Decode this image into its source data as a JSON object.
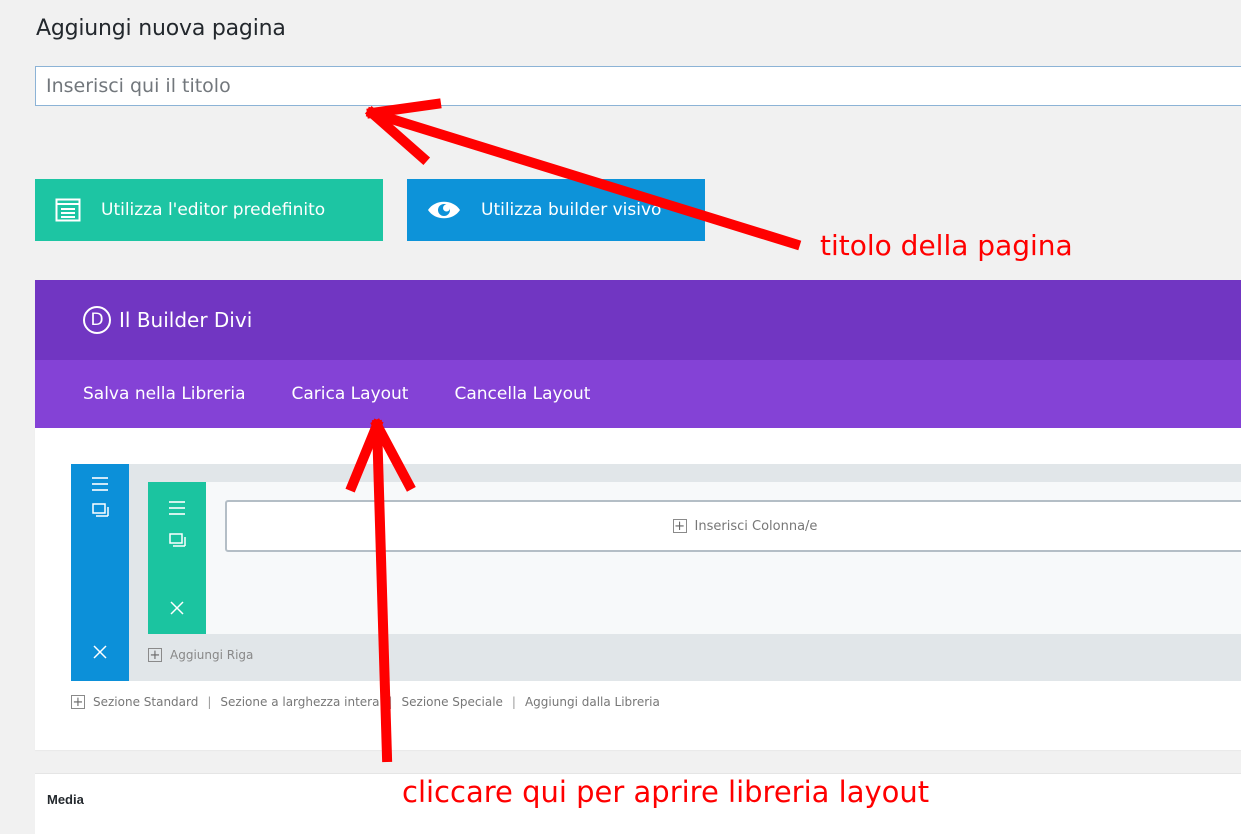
{
  "page": {
    "heading": "Aggiungi nuova pagina",
    "title_placeholder": "Inserisci qui il titolo"
  },
  "buttons": {
    "default_editor": "Utilizza l'editor predefinito",
    "visual_builder": "Utilizza builder visivo"
  },
  "builder": {
    "logo_letter": "D",
    "title": "Il Builder Divi",
    "toolbar": [
      "Salva nella Libreria",
      "Carica Layout",
      "Cancella Layout"
    ],
    "insert_columns": "Inserisci Colonna/e",
    "add_row": "Aggiungi Riga",
    "section_links": [
      "Sezione Standard",
      "Sezione a larghezza intera",
      "Sezione Speciale",
      "Aggiungi dalla Libreria"
    ]
  },
  "media_box": {
    "label": "Media"
  },
  "annotations": {
    "title_note": "titolo della pagina",
    "layout_note": "cliccare qui per aprire libreria layout",
    "color": "#ff0000"
  },
  "colors": {
    "builder_header": "#7136c2",
    "builder_toolbar": "#8442d6",
    "default_button": "#1dc5a3",
    "visual_button": "#0d93d9"
  }
}
